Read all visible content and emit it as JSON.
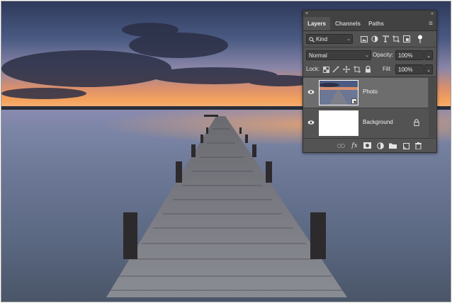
{
  "panel": {
    "collapse_glyph": "«",
    "close_glyph": "×",
    "menu_glyph": "≡",
    "tabs": [
      {
        "label": "Layers",
        "active": true
      },
      {
        "label": "Channels",
        "active": false
      },
      {
        "label": "Paths",
        "active": false
      }
    ],
    "filter": {
      "value": "Kind",
      "icons": [
        "image-filter-icon",
        "adjustment-filter-icon",
        "type-filter-icon",
        "shape-filter-icon",
        "smart-object-filter-icon",
        "filter-toggle-icon"
      ]
    },
    "blend_mode": "Normal",
    "opacity": {
      "label": "Opacity:",
      "value": "100%"
    },
    "lock": {
      "label": "Lock:",
      "icons": [
        "lock-transparent-icon",
        "lock-image-icon",
        "lock-position-icon",
        "lock-artboard-icon",
        "lock-all-icon"
      ]
    },
    "fill": {
      "label": "Fill:",
      "value": "100%"
    },
    "layers": [
      {
        "name": "Photo",
        "visible": true,
        "selected": true,
        "smart_object": true
      },
      {
        "name": "Background",
        "visible": true,
        "selected": false,
        "locked": true
      }
    ],
    "footer_icons": [
      "link-layers-icon",
      "fx-icon",
      "add-mask-icon",
      "new-adjustment-icon",
      "new-group-icon",
      "new-layer-icon",
      "delete-icon"
    ],
    "fx_label": "fx"
  },
  "colors": {
    "panel_bg": "#535353",
    "selected_layer": "#6d6d6d",
    "sky_top": "#3a4668",
    "sunset": "#f08a4a",
    "water": "#5e6d86"
  }
}
